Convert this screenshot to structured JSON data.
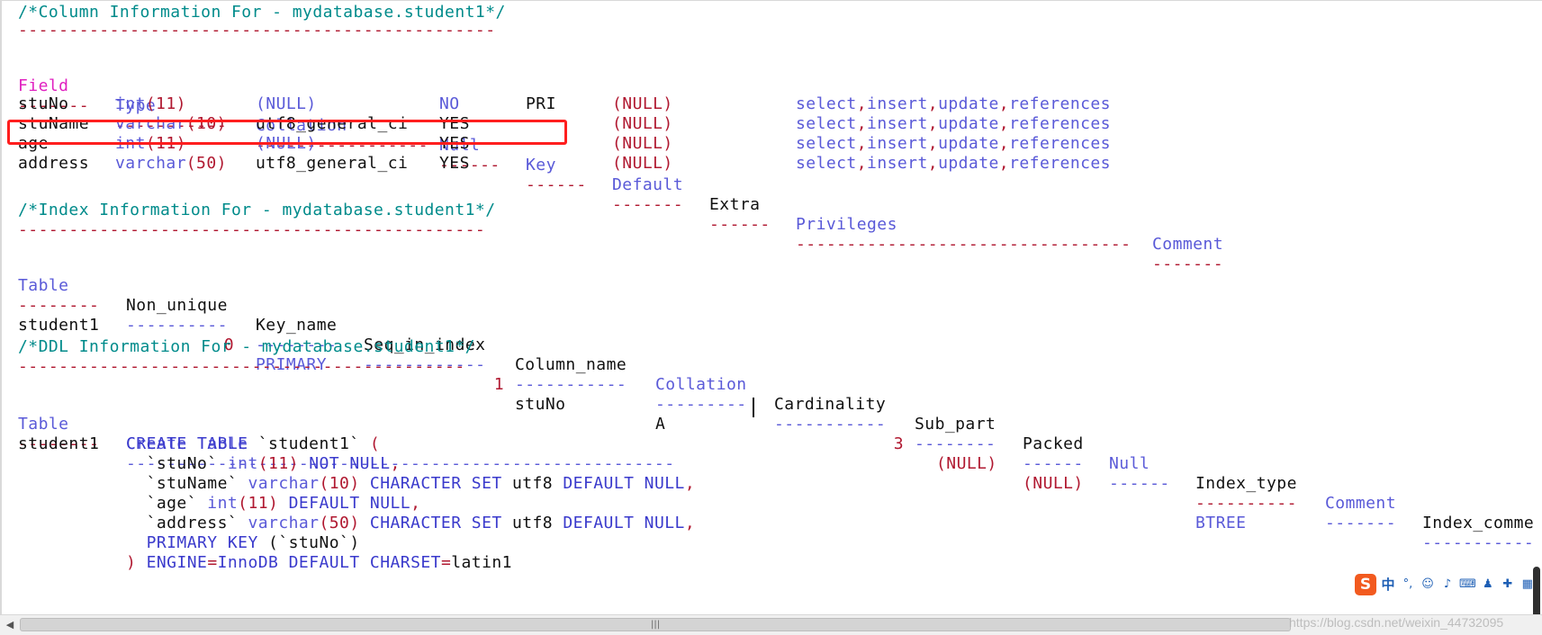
{
  "column_info": {
    "header_comment": "/*Column Information For - mydatabase.student1*/",
    "header_dashes": "-----------------------------------------------",
    "columns": [
      "Field",
      "Type",
      "Collation",
      "Null",
      "Key",
      "Default",
      "Extra",
      "Privileges",
      "Comment"
    ],
    "column_dashes": [
      "-------",
      "-----------",
      "-----------------",
      "------",
      "------",
      "-------",
      "------",
      "---------------------------------",
      "-------"
    ],
    "rows": [
      {
        "field": "stuNo",
        "type_name": "int",
        "type_args": "(11)",
        "collation": "(NULL)",
        "null": "NO",
        "key": "PRI",
        "default": "(NULL)",
        "privileges": [
          "select",
          ",",
          "insert",
          ",",
          "update",
          ",",
          "references"
        ]
      },
      {
        "field": "stuName",
        "type_name": "varchar",
        "type_args": "(10)",
        "collation": "utf8_general_ci",
        "null": "YES",
        "key": "",
        "default": "(NULL)",
        "privileges": [
          "select",
          ",",
          "insert",
          ",",
          "update",
          ",",
          "references"
        ]
      },
      {
        "field": "age",
        "type_name": "int",
        "type_args": "(11)",
        "collation": "(NULL)",
        "null": "YES",
        "key": "",
        "default": "(NULL)",
        "privileges": [
          "select",
          ",",
          "insert",
          ",",
          "update",
          ",",
          "references"
        ]
      },
      {
        "field": "address",
        "type_name": "varchar",
        "type_args": "(50)",
        "collation": "utf8_general_ci",
        "null": "YES",
        "key": "",
        "default": "(NULL)",
        "privileges": [
          "select",
          ",",
          "insert",
          ",",
          "update",
          ",",
          "references"
        ]
      }
    ]
  },
  "index_info": {
    "header_comment": "/*Index Information For - mydatabase.student1*/",
    "header_dashes": "----------------------------------------------",
    "columns": [
      "Table",
      "Non_unique",
      "Key_name",
      "Seq_in_index",
      "Column_name",
      "Collation",
      "Cardinality",
      "Sub_part",
      "Packed",
      "Null",
      "Index_type",
      "Comment",
      "Index_comme"
    ],
    "column_dashes": [
      "--------",
      "----------",
      "--------",
      "------------",
      "-----------",
      "---------",
      "-----------",
      "--------",
      "------",
      "------",
      "----------",
      "-------",
      "-----------"
    ],
    "row": {
      "table": "student1",
      "non_unique": "0",
      "key_name": "PRIMARY",
      "seq_in_index": "1",
      "column_name": "stuNo",
      "collation": "A",
      "cardinality": "3",
      "sub_part": "(NULL)",
      "packed": "(NULL)",
      "null": "",
      "index_type": "BTREE"
    }
  },
  "ddl_info": {
    "header_comment": "/*DDL Information For - mydatabase.student1*/",
    "header_dashes": "--------------------------------------------",
    "columns": [
      "Table",
      "Create Table"
    ],
    "column_dashes": [
      "--------",
      "------------------------------------------------------"
    ],
    "table": "student1",
    "lines": [
      [
        {
          "t": "CREATE TABLE",
          "c": "kw"
        },
        {
          "t": " `student1` ",
          "c": "black"
        },
        {
          "t": "(",
          "c": "num"
        }
      ],
      [
        {
          "t": "  `stuNo` ",
          "c": "black"
        },
        {
          "t": "int",
          "c": "blue"
        },
        {
          "t": "(11)",
          "c": "num"
        },
        {
          "t": " NOT NULL",
          "c": "kw"
        },
        {
          "t": ",",
          "c": "num"
        }
      ],
      [
        {
          "t": "  `stuName` ",
          "c": "black"
        },
        {
          "t": "varchar",
          "c": "blue"
        },
        {
          "t": "(10)",
          "c": "num"
        },
        {
          "t": " CHARACTER SET ",
          "c": "kw"
        },
        {
          "t": "utf8",
          "c": "black"
        },
        {
          "t": " DEFAULT NULL",
          "c": "kw"
        },
        {
          "t": ",",
          "c": "num"
        }
      ],
      [
        {
          "t": "  `age` ",
          "c": "black"
        },
        {
          "t": "int",
          "c": "blue"
        },
        {
          "t": "(11)",
          "c": "num"
        },
        {
          "t": " DEFAULT NULL",
          "c": "kw"
        },
        {
          "t": ",",
          "c": "num"
        }
      ],
      [
        {
          "t": "  `address` ",
          "c": "black"
        },
        {
          "t": "varchar",
          "c": "blue"
        },
        {
          "t": "(50)",
          "c": "num"
        },
        {
          "t": " CHARACTER SET ",
          "c": "kw"
        },
        {
          "t": "utf8",
          "c": "black"
        },
        {
          "t": " DEFAULT NULL",
          "c": "kw"
        },
        {
          "t": ",",
          "c": "num"
        }
      ],
      [
        {
          "t": "  PRIMARY KEY ",
          "c": "kw"
        },
        {
          "t": "(`stuNo`)",
          "c": "black"
        }
      ],
      [
        {
          "t": ") ",
          "c": "num"
        },
        {
          "t": "ENGINE",
          "c": "kw"
        },
        {
          "t": "=",
          "c": "num"
        },
        {
          "t": "InnoDB",
          "c": "kw"
        },
        {
          "t": " DEFAULT CHARSET",
          "c": "kw"
        },
        {
          "t": "=",
          "c": "num"
        },
        {
          "t": "latin1",
          "c": "black"
        }
      ]
    ]
  },
  "ime_toolbar": {
    "logo": "S",
    "items": [
      {
        "icon": "chinese-mode-icon",
        "glyph": "中"
      },
      {
        "icon": "punctuation-icon",
        "glyph": "°,"
      },
      {
        "icon": "emoji-icon",
        "glyph": "☺"
      },
      {
        "icon": "microphone-icon",
        "glyph": "♪"
      },
      {
        "icon": "keyboard-icon",
        "glyph": "⌨"
      },
      {
        "icon": "user-icon",
        "glyph": "♟"
      },
      {
        "icon": "skin-icon",
        "glyph": "✚"
      },
      {
        "icon": "grid-icon",
        "glyph": "▦"
      }
    ]
  },
  "watermark": "https://blog.csdn.net/weixin_44732095",
  "colors": {
    "comment": "#008b8b",
    "dashes": "#b01830",
    "field_header": "#e020c0",
    "header": "#5a5ad8",
    "keyword": "#3a3acc",
    "highlight_box": "#ff1e1e"
  }
}
